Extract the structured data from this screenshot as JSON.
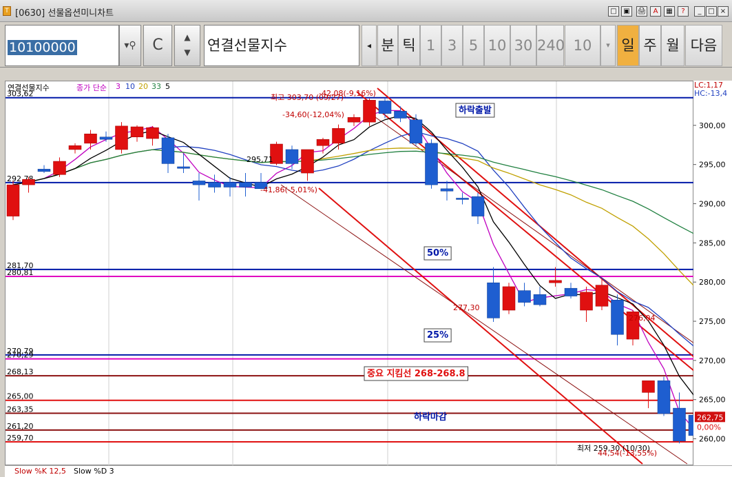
{
  "window": {
    "title": "[0630] 선물옵션미니차트",
    "title_buttons": [
      "□",
      "▣",
      "🖨",
      "A",
      "▦",
      "?",
      "_",
      "□",
      "×"
    ]
  },
  "toolbar": {
    "code": "10100000",
    "code_button": "C",
    "name": "연결선물지수",
    "period_buttons": [
      "분",
      "틱",
      "1",
      "3",
      "5",
      "10",
      "30",
      "240"
    ],
    "period_value": "10",
    "range_buttons": [
      "일",
      "주",
      "월"
    ],
    "active_range": "일",
    "next_button": "다음"
  },
  "legend": {
    "title": "연결선물지수",
    "ma_label": "종가 단순",
    "ma_periods": [
      "3",
      "10",
      "20",
      "33",
      "5"
    ],
    "ma_colors": [
      "#c000c0",
      "#2040c0",
      "#c0a000",
      "#208040",
      "#000000"
    ]
  },
  "corner_labels": {
    "lc": "LC:1,17",
    "hc": "HC:-13,4"
  },
  "bottom": {
    "k_label": "Slow %K 12,5",
    "d_label": "Slow %D 3"
  },
  "chart_data": {
    "type": "candlestick",
    "y_ticks": [
      "300,00",
      "295,00",
      "290,00",
      "285,00",
      "280,00",
      "275,00",
      "270,00",
      "265,00",
      "260,00"
    ],
    "ylim": [
      257.5,
      305.0
    ],
    "candles": [
      {
        "o": 288.5,
        "h": 293.0,
        "l": 288.0,
        "c": 292.5
      },
      {
        "o": 292.5,
        "h": 293.5,
        "l": 291.5,
        "c": 293.2
      },
      {
        "o": 294.5,
        "h": 295.0,
        "l": 294.0,
        "c": 294.2
      },
      {
        "o": 293.8,
        "h": 296.0,
        "l": 293.5,
        "c": 295.5
      },
      {
        "o": 297.0,
        "h": 297.8,
        "l": 296.5,
        "c": 297.5
      },
      {
        "o": 297.8,
        "h": 299.5,
        "l": 297.0,
        "c": 299.0
      },
      {
        "o": 298.6,
        "h": 299.3,
        "l": 298.0,
        "c": 298.3
      },
      {
        "o": 297.0,
        "h": 300.5,
        "l": 296.5,
        "c": 300.0
      },
      {
        "o": 298.6,
        "h": 300.1,
        "l": 298.0,
        "c": 299.9
      },
      {
        "o": 298.4,
        "h": 300.0,
        "l": 297.5,
        "c": 299.8
      },
      {
        "o": 298.5,
        "h": 299.0,
        "l": 294.0,
        "c": 295.2
      },
      {
        "o": 294.8,
        "h": 296.5,
        "l": 294.0,
        "c": 294.6
      },
      {
        "o": 293.0,
        "h": 294.0,
        "l": 290.5,
        "c": 292.5
      },
      {
        "o": 292.8,
        "h": 293.8,
        "l": 291.5,
        "c": 292.2
      },
      {
        "o": 292.8,
        "h": 293.5,
        "l": 291.0,
        "c": 292.2
      },
      {
        "o": 292.8,
        "h": 294.0,
        "l": 291.0,
        "c": 292.2
      },
      {
        "o": 292.8,
        "h": 294.0,
        "l": 292.0,
        "c": 292.0
      },
      {
        "o": 295.2,
        "h": 298.0,
        "l": 295.0,
        "c": 297.7
      },
      {
        "o": 297.0,
        "h": 297.5,
        "l": 294.5,
        "c": 295.2
      },
      {
        "o": 294.0,
        "h": 297.0,
        "l": 293.0,
        "c": 297.0
      },
      {
        "o": 297.5,
        "h": 298.5,
        "l": 296.5,
        "c": 298.3
      },
      {
        "o": 297.8,
        "h": 300.2,
        "l": 297.0,
        "c": 299.7
      },
      {
        "o": 300.5,
        "h": 301.5,
        "l": 300.0,
        "c": 301.1
      },
      {
        "o": 300.5,
        "h": 303.5,
        "l": 300.0,
        "c": 303.3
      },
      {
        "o": 303.2,
        "h": 303.5,
        "l": 301.0,
        "c": 301.6
      },
      {
        "o": 301.9,
        "h": 302.5,
        "l": 300.5,
        "c": 301.0
      },
      {
        "o": 300.8,
        "h": 301.5,
        "l": 297.5,
        "c": 297.8
      },
      {
        "o": 297.8,
        "h": 298.3,
        "l": 292.0,
        "c": 292.5
      },
      {
        "o": 292.0,
        "h": 293.0,
        "l": 290.5,
        "c": 291.7
      },
      {
        "o": 290.8,
        "h": 291.5,
        "l": 290.0,
        "c": 290.7
      },
      {
        "o": 291.0,
        "h": 291.5,
        "l": 287.5,
        "c": 288.5
      },
      {
        "o": 280.0,
        "h": 282.0,
        "l": 275.0,
        "c": 275.5
      },
      {
        "o": 276.5,
        "h": 280.0,
        "l": 276.0,
        "c": 279.5
      },
      {
        "o": 279.0,
        "h": 280.0,
        "l": 277.0,
        "c": 277.5
      },
      {
        "o": 278.5,
        "h": 279.5,
        "l": 277.0,
        "c": 277.2
      },
      {
        "o": 280.0,
        "h": 282.0,
        "l": 279.5,
        "c": 280.3
      },
      {
        "o": 279.3,
        "h": 280.0,
        "l": 278.0,
        "c": 278.3
      },
      {
        "o": 276.5,
        "h": 279.5,
        "l": 275.0,
        "c": 278.8
      },
      {
        "o": 277.0,
        "h": 280.5,
        "l": 276.5,
        "c": 279.7
      },
      {
        "o": 277.8,
        "h": 278.5,
        "l": 272.0,
        "c": 273.4
      },
      {
        "o": 272.8,
        "h": 276.5,
        "l": 272.0,
        "c": 276.3
      },
      {
        "o": 266.0,
        "h": 267.5,
        "l": 264.0,
        "c": 267.5
      },
      {
        "o": 267.5,
        "h": 268.0,
        "l": 263.0,
        "c": 263.3
      },
      {
        "o": 264.0,
        "h": 266.0,
        "l": 259.5,
        "c": 259.8
      },
      {
        "o": 263.1,
        "h": 265.5,
        "l": 259.5,
        "c": 260.5
      }
    ],
    "hlines": [
      {
        "value": 303.62,
        "color": "#0018a8",
        "label": "303,62"
      },
      {
        "value": 292.78,
        "color": "#0018a8",
        "label": "292,78"
      },
      {
        "value": 281.7,
        "color": "#0018a8",
        "label": "281,70"
      },
      {
        "value": 280.81,
        "color": "#e000c0",
        "label": "280,81"
      },
      {
        "value": 270.79,
        "color": "#0018a8",
        "label": "270,79"
      },
      {
        "value": 270.29,
        "color": "#e000c0",
        "label": "270,29"
      },
      {
        "value": 268.13,
        "color": "#8b1010",
        "label": "268,13"
      },
      {
        "value": 265.0,
        "color": "#e01010",
        "label": "265,00"
      },
      {
        "value": 263.35,
        "color": "#8b1010",
        "label": "263,35"
      },
      {
        "value": 261.2,
        "color": "#8b1010",
        "label": "261,20"
      },
      {
        "value": 259.7,
        "color": "#e01010",
        "label": "259,70"
      }
    ],
    "annotations": [
      {
        "text": "하락출발",
        "boxed": true,
        "color": "#0018a8"
      },
      {
        "text": "50%",
        "boxed": true,
        "color": "#0018a8"
      },
      {
        "text": "25%",
        "boxed": true,
        "color": "#0018a8"
      },
      {
        "text": "중요  지킴선  268-268.8",
        "boxed": true,
        "color": "#e01010"
      },
      {
        "text": "하락마감",
        "boxed": false,
        "color": "#0018a8"
      }
    ],
    "price_notes": [
      {
        "text": "최고 303,70 (09/27)",
        "color": "#c00000"
      },
      {
        "text": "-42,08(-9,16%)",
        "color": "#c00000"
      },
      {
        "text": "-34,60(-12,04%)",
        "color": "#c00000"
      },
      {
        "text": "295,71",
        "color": "#000000"
      },
      {
        "text": "-41,86(-5,01%)",
        "color": "#c00000"
      },
      {
        "text": "277,30",
        "color": "#c00000"
      },
      {
        "text": "276,04",
        "color": "#c00000"
      },
      {
        "text": "최저 259,30 (10/30)",
        "color": "#000000"
      },
      {
        "text": "44,54(-13,55%)",
        "color": "#c00000"
      }
    ],
    "last_price_label": "262,75",
    "last_pct_label": "0,00%"
  }
}
